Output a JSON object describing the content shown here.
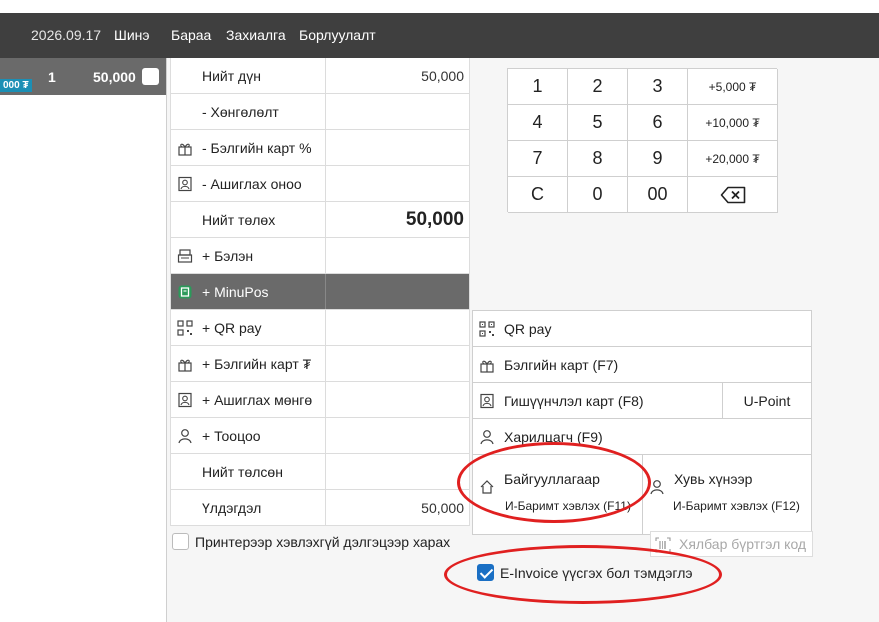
{
  "topbar": {
    "date": "2026.09.17",
    "nav": [
      "Шинэ",
      "Бараа",
      "Захиалга",
      "Борлуулалт"
    ]
  },
  "order": {
    "price_badge": "000 ₮",
    "qty": "1",
    "sum": "50,000"
  },
  "payment_table": [
    {
      "label": "Нийт дүн",
      "value": "50,000",
      "icon": "",
      "big": false
    },
    {
      "label": "- Хөнгөлөлт",
      "value": "",
      "icon": "",
      "big": false
    },
    {
      "label": "- Бэлгийн карт %",
      "value": "",
      "icon": "gift-card-icon",
      "big": false
    },
    {
      "label": "- Ашиглах оноо",
      "value": "",
      "icon": "member-card-icon",
      "big": false
    },
    {
      "label": "Нийт төлөх",
      "value": "50,000",
      "icon": "",
      "big": true
    },
    {
      "label": "+ Бэлэн",
      "value": "",
      "icon": "cash-register-icon",
      "big": false
    },
    {
      "label": "+ MinuPos",
      "value": "",
      "icon": "minupos-icon",
      "big": false,
      "active": true
    },
    {
      "label": "+ QR pay",
      "value": "",
      "icon": "qr-icon",
      "big": false
    },
    {
      "label": "+ Бэлгийн карт ₮",
      "value": "",
      "icon": "gift-card-icon",
      "big": false
    },
    {
      "label": "+ Ашиглах мөнгө",
      "value": "",
      "icon": "member-card-icon",
      "big": false
    },
    {
      "label": "+ Тооцоо",
      "value": "",
      "icon": "person-icon",
      "big": false
    },
    {
      "label": "Нийт төлсөн",
      "value": "",
      "icon": "",
      "big": false
    },
    {
      "label": "Үлдэгдэл",
      "value": "50,000",
      "icon": "",
      "big": false
    }
  ],
  "keypad": [
    "1",
    "2",
    "3",
    "+5,000 ₮",
    "4",
    "5",
    "6",
    "+10,000 ₮",
    "7",
    "8",
    "9",
    "+20,000 ₮",
    "C",
    "0",
    "00",
    "backspace"
  ],
  "methods": {
    "qr_pay": "QR pay",
    "gift_card": "Бэлгийн карт (F7)",
    "membership": "Гишүүнчлэл карт (F8)",
    "u_point": "U-Point",
    "customer": "Харилцагч (F9)",
    "organization": "Байгууллагаар",
    "organization_sub": "И-Баримт хэвлэх (F11)",
    "individual": "Хувь хүнээр",
    "individual_sub": "И-Баримт хэвлэх (F12)"
  },
  "printer_label": "Принтерээр хэвлэхгүй дэлгэцээр харах",
  "easy_register": "Хялбар бүртгэл код",
  "einvoice_label": "E-Invoice үүсгэх бол тэмдэглэ",
  "colors": {
    "topbar": "#3f3f3f",
    "active_row": "#6a6a6a",
    "badge": "#1b8fb5",
    "checkbox": "#1a6fc4",
    "highlight": "#e02020"
  }
}
